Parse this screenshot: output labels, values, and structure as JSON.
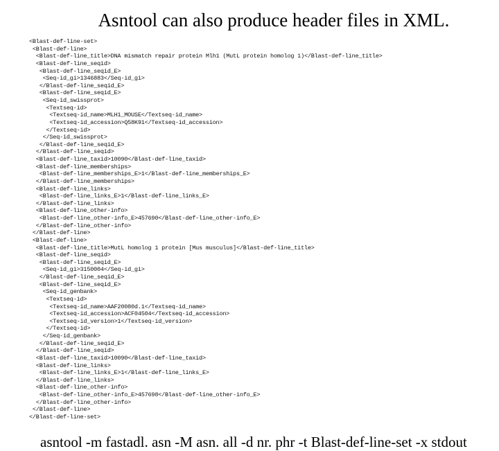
{
  "title": "Asntool can also produce header files in XML.",
  "xml": "<Blast-def-line-set>\n <Blast-def-line>\n  <Blast-def-line_title>DNA mismatch repair protein Mlh1 (MutL protein homolog 1)</Blast-def-line_title>\n  <Blast-def-line_seqid>\n   <Blast-def-line_seqid_E>\n    <Seq-id_gi>1346883</Seq-id_gi>\n   </Blast-def-line_seqid_E>\n   <Blast-def-line_seqid_E>\n    <Seq-id_swissprot>\n     <Textseq-id>\n      <Textseq-id_name>MLH1_MOUSE</Textseq-id_name>\n      <Textseq-id_accession>Q58K91</Textseq-id_accession>\n     </Textseq-id>\n    </Seq-id_swissprot>\n   </Blast-def-line_seqid_E>\n  </Blast-def-line_seqid>\n  <Blast-def-line_taxid>10090</Blast-def-line_taxid>\n  <Blast-def-line_memberships>\n   <Blast-def-line_memberships_E>1</Blast-def-line_memberships_E>\n  </Blast-def-line_memberships>\n  <Blast-def-line_links>\n   <Blast-def-line_links_E>1</Blast-def-line_links_E>\n  </Blast-def-line_links>\n  <Blast-def-line_other-info>\n   <Blast-def-line_other-info_E>457690</Blast-def-line_other-info_E>\n  </Blast-def-line_other-info>\n </Blast-def-line>\n <Blast-def-line>\n  <Blast-def-line_title>MutL homolog 1 protein [Mus musculus]</Blast-def-line_title>\n  <Blast-def-line_seqid>\n   <Blast-def-line_seqid_E>\n    <Seq-id_gi>3150004</Seq-id_gi>\n   </Blast-def-line_seqid_E>\n   <Blast-def-line_seqid_E>\n    <Seq-id_genbank>\n     <Textseq-id>\n      <Textseq-id_name>AAF20080d.1</Textseq-id_name>\n      <Textseq-id_accession>ACF04504</Textseq-id_accession>\n      <Textseq-id_version>1</Textseq-id_version>\n     </Textseq-id>\n    </Seq-id_genbank>\n   </Blast-def-line_seqid_E>\n  </Blast-def-line_seqid>\n  <Blast-def-line_taxid>10090</Blast-def-line_taxid>\n  <Blast-def-line_links>\n   <Blast-def-line_links_E>1</Blast-def-line_links_E>\n  </Blast-def-line_links>\n  <Blast-def-line_other-info>\n   <Blast-def-line_other-info_E>457698</Blast-def-line_other-info_E>\n  </Blast-def-line_other-info>\n </Blast-def-line>\n</Blast-def-line-set>",
  "command": "asntool -m fastadl. asn -M asn. all -d nr. phr -t Blast-def-line-set -x stdout"
}
